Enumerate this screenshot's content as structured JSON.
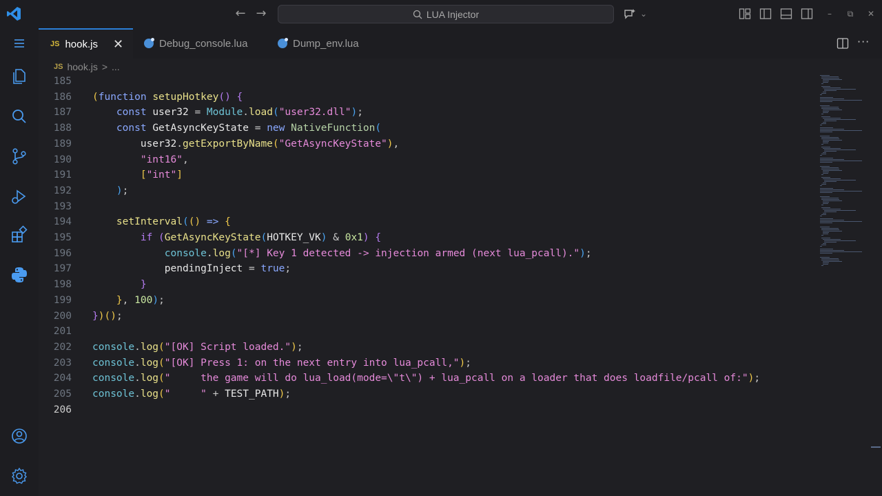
{
  "window": {
    "search_label": "LUA Injector"
  },
  "tabs": [
    {
      "badge": "JS",
      "label": "hook.js",
      "active": true
    },
    {
      "label": "Debug_console.lua",
      "active": false
    },
    {
      "label": "Dump_env.lua",
      "active": false
    }
  ],
  "breadcrumb": {
    "badge": "JS",
    "file": "hook.js",
    "separator": ">",
    "more": "..."
  },
  "editor": {
    "current_line": 206,
    "lines": [
      {
        "n": "185",
        "code": ""
      },
      {
        "n": "186",
        "code": "(function setupHotkey() {"
      },
      {
        "n": "187",
        "code": "    const user32 = Module.load(\"user32.dll\");"
      },
      {
        "n": "188",
        "code": "    const GetAsyncKeyState = new NativeFunction("
      },
      {
        "n": "189",
        "code": "        user32.getExportByName(\"GetAsyncKeyState\"),"
      },
      {
        "n": "190",
        "code": "        \"int16\","
      },
      {
        "n": "191",
        "code": "        [\"int\"]"
      },
      {
        "n": "192",
        "code": "    );"
      },
      {
        "n": "193",
        "code": ""
      },
      {
        "n": "194",
        "code": "    setInterval(() => {"
      },
      {
        "n": "195",
        "code": "        if (GetAsyncKeyState(HOTKEY_VK) & 0x1) {"
      },
      {
        "n": "196",
        "code": "            console.log(\"[*] Key 1 detected -> injection armed (next lua_pcall).\");"
      },
      {
        "n": "197",
        "code": "            pendingInject = true;"
      },
      {
        "n": "198",
        "code": "        }"
      },
      {
        "n": "199",
        "code": "    }, 100);"
      },
      {
        "n": "200",
        "code": "})();"
      },
      {
        "n": "201",
        "code": ""
      },
      {
        "n": "202",
        "code": "console.log(\"[OK] Script loaded.\");"
      },
      {
        "n": "203",
        "code": "console.log(\"[OK] Press 1: on the next entry into lua_pcall,\");"
      },
      {
        "n": "204",
        "code": "console.log(\"     the game will do lua_load(mode=\\\"t\\\") + lua_pcall on a loader that does loadfile/pcall of:\");"
      },
      {
        "n": "205",
        "code": "console.log(\"     \" + TEST_PATH);"
      },
      {
        "n": "206",
        "code": ""
      }
    ]
  }
}
